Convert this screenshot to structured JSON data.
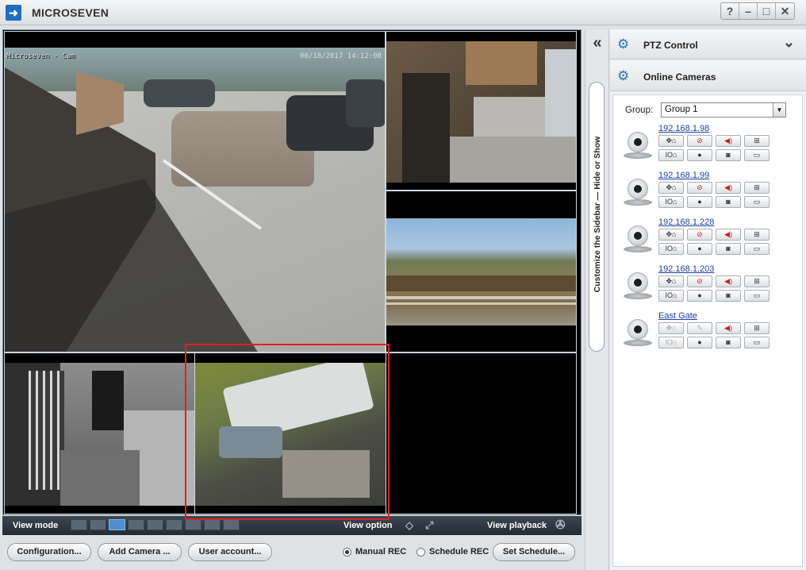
{
  "app": {
    "title": "MICROSEVEN"
  },
  "window_buttons": [
    "?",
    "–",
    "□",
    "✕"
  ],
  "feeds": {
    "cam1_osd_left": "Microseven - Cam",
    "cam1_osd_right": "06/18/2017 14:12:08"
  },
  "video_bar": {
    "view_mode_label": "View mode",
    "view_option_label": "View option",
    "view_playback_label": "View playback",
    "layout_count": 9,
    "selected_layout_index": 2
  },
  "bottom": {
    "configuration": "Configuration...",
    "add_camera": "Add Camera ...",
    "user_account": "User account...",
    "manual_rec": "Manual REC",
    "schedule_rec": "Schedule REC",
    "set_schedule": "Set Schedule..."
  },
  "sidebar_toggle": {
    "label": "Customize the Sidebar — Hide or Show"
  },
  "sidebar": {
    "ptz_title": "PTZ Control",
    "online_title": "Online Cameras",
    "group_label": "Group:",
    "group_value": "Group 1",
    "cameras": [
      {
        "name": "192.168.1.98"
      },
      {
        "name": "192.168.1.99"
      },
      {
        "name": "192.168.1.228"
      },
      {
        "name": "192.168.1.203"
      },
      {
        "name": "East Gate"
      }
    ]
  },
  "colors": {
    "accent": "#2a74c9",
    "highlight": "#e02020",
    "link": "#1a3fa8"
  }
}
